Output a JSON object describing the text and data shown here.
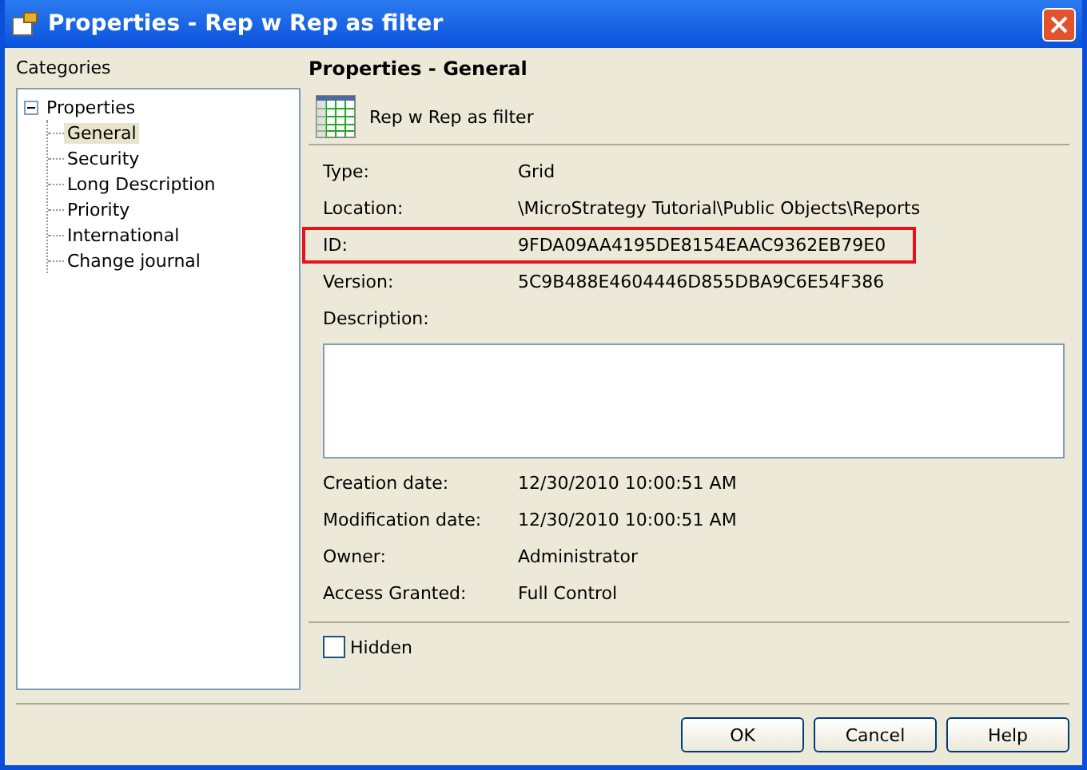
{
  "window": {
    "title": "Properties - Rep w Rep as filter"
  },
  "categories": {
    "label": "Categories",
    "tree": [
      {
        "label": "Properties",
        "expanded": true,
        "selected": false,
        "children": [
          {
            "label": "General",
            "selected": true
          },
          {
            "label": "Security",
            "selected": false
          },
          {
            "label": "Long Description",
            "selected": false
          },
          {
            "label": "Priority",
            "selected": false
          },
          {
            "label": "International",
            "selected": false
          },
          {
            "label": "Change journal",
            "selected": false
          }
        ]
      }
    ]
  },
  "panel": {
    "title": "Properties - General",
    "object_name": "Rep w Rep as filter",
    "properties": [
      {
        "label": "Type:",
        "value": "Grid",
        "highlighted": false
      },
      {
        "label": "Location:",
        "value": "\\MicroStrategy Tutorial\\Public Objects\\Reports",
        "highlighted": false
      },
      {
        "label": "ID:",
        "value": "9FDA09AA4195DE8154EAAC9362EB79E0",
        "highlighted": true
      },
      {
        "label": "Version:",
        "value": "5C9B488E4604446D855DBA9C6E54F386",
        "highlighted": false
      }
    ],
    "description_label": "Description:",
    "dates": [
      {
        "label": "Creation date:",
        "value": "12/30/2010 10:00:51 AM"
      },
      {
        "label": "Modification date:",
        "value": "12/30/2010 10:00:51 AM"
      },
      {
        "label": "Owner:",
        "value": "Administrator"
      },
      {
        "label": "Access Granted:",
        "value": "Full Control"
      }
    ],
    "hidden": {
      "label": "Hidden",
      "checked": false
    }
  },
  "buttons": [
    "OK",
    "Cancel",
    "Help"
  ]
}
